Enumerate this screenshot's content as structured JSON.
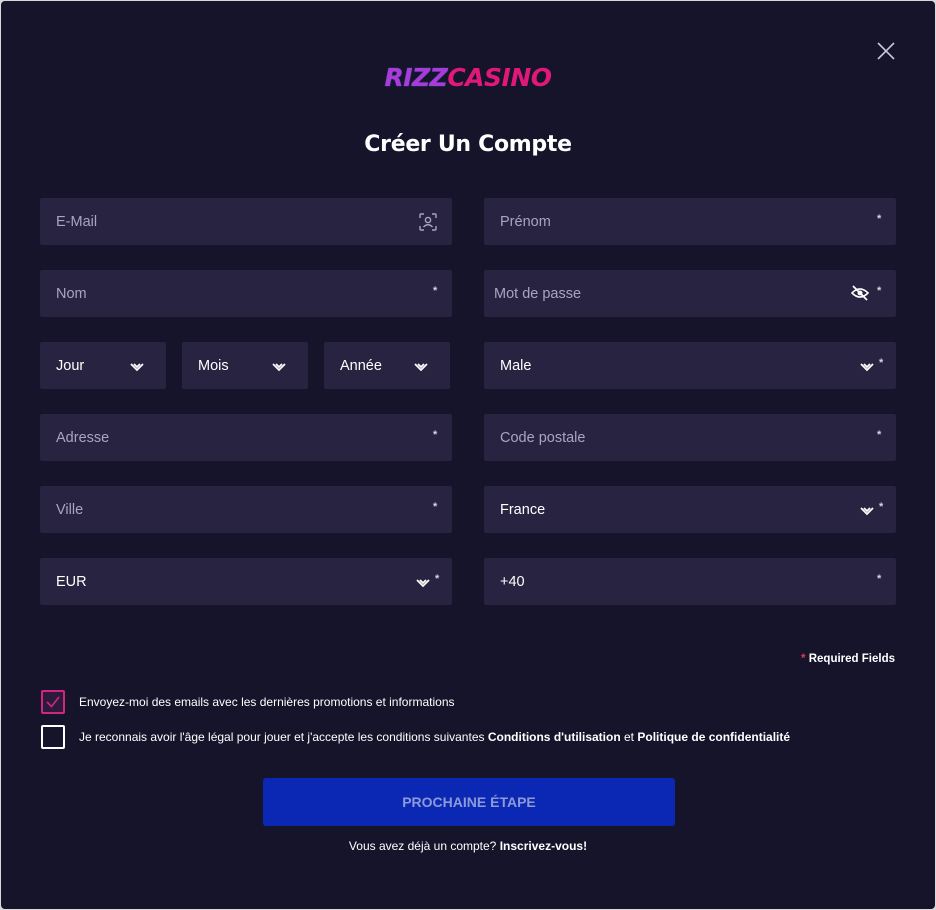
{
  "brand": {
    "logo_part1": "RIZZ",
    "logo_part2": "CASINO"
  },
  "title": "Créer Un Compte",
  "fields": {
    "email": {
      "placeholder": "E-Mail"
    },
    "first_name": {
      "placeholder": "Prénom",
      "required": "*"
    },
    "last_name": {
      "placeholder": "Nom",
      "required": "*"
    },
    "password": {
      "placeholder": "Mot de passe",
      "required": "*"
    },
    "day": {
      "value": "Jour"
    },
    "month": {
      "value": "Mois"
    },
    "year": {
      "value": "Année"
    },
    "gender": {
      "value": "Male",
      "required": "*"
    },
    "address": {
      "placeholder": "Adresse",
      "required": "*"
    },
    "postal_code": {
      "placeholder": "Code postale",
      "required": "*"
    },
    "city": {
      "placeholder": "Ville",
      "required": "*"
    },
    "country": {
      "value": "France",
      "required": "*"
    },
    "currency": {
      "value": "EUR",
      "required": "*"
    },
    "phone": {
      "value": "+40",
      "required": "*"
    }
  },
  "required_note": {
    "star": "*",
    "text": " Required Fields"
  },
  "consents": {
    "promo": {
      "checked": true,
      "text": "Envoyez-moi des emails avec les dernières promotions et informations"
    },
    "terms": {
      "checked": false,
      "text": "Je reconnais avoir l'âge légal pour jouer et j'accepte les conditions suivantes ",
      "link1": "Conditions d'utilisation",
      "and": " et ",
      "link2": "Politique de confidentialité"
    }
  },
  "submit_label": "PROCHAINE ÉTAPE",
  "login_prompt": {
    "text": "Vous avez déjà un compte? ",
    "link": "Inscrivez-vous!"
  },
  "colors": {
    "background": "#16142a",
    "field": "#272341",
    "primary_button": "#0b28b4",
    "accent": "#d0267e"
  },
  "icons": {
    "close": "close-icon",
    "email": "face-scan-icon",
    "password": "eye-off-icon",
    "select": "chevron-down-icon"
  }
}
